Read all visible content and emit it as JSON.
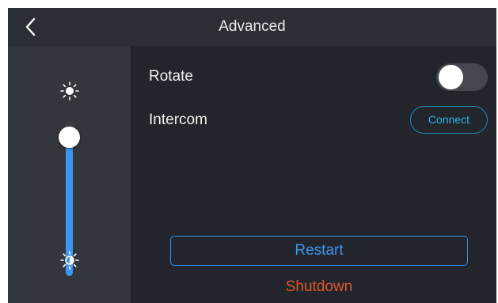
{
  "header": {
    "title": "Advanced",
    "back_icon": "chevron-left-icon"
  },
  "sidebar": {
    "brightness_high_icon": "sun-icon",
    "brightness_low_icon": "half-sun-icon",
    "brightness_level": 0.9
  },
  "settings": {
    "rotate_label": "Rotate",
    "rotate_enabled": false,
    "intercom_label": "Intercom",
    "connect_label": "Connect"
  },
  "actions": {
    "restart_label": "Restart",
    "shutdown_label": "Shutdown"
  },
  "colors": {
    "background": "#22252b",
    "header": "#2c2f35",
    "sidebar": "#33363c",
    "slider_fill": "#3f95f2",
    "connect": "#2bb3e0",
    "restart": "#3f95f2",
    "shutdown": "#e0562a"
  }
}
